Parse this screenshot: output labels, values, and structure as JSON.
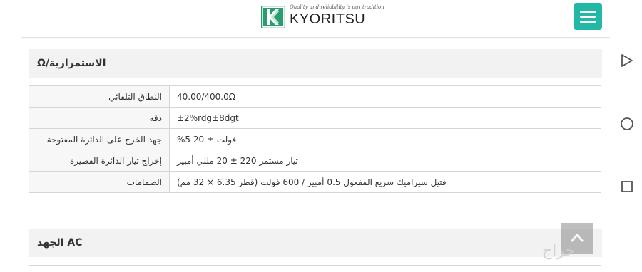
{
  "header": {
    "logo_tagline": "Quality and reliability is our tradition",
    "logo_word": "KYORITSU"
  },
  "section_continuity": {
    "title": "Ω/الاستمرارية"
  },
  "spec_table": [
    {
      "label": "النطاق التلقائي",
      "value": "40.00/400.0Ω"
    },
    {
      "label": "دقة",
      "value": "±2%rdg±8dgt"
    },
    {
      "label": "جهد الخرج على الدائرة المفتوحة",
      "value": "%فولت ± 20 5"
    },
    {
      "label": "إخراج تيار الدائرة القصيرة",
      "value": "تيار مستمر 220 ± 20 مللي أمبير"
    },
    {
      "label": "الصمامات",
      "value": "فتيل سيراميك سريع المفعول 0.5 أمبير / 600 فولت (قطر 6.35 × 32 مم)"
    }
  ],
  "section_ac": {
    "title": "الجهد AC"
  },
  "watermark": "حراج",
  "colors": {
    "menu_button": "#21b8a6",
    "logo_green": "#2a9d6f",
    "section_bg": "#f2f2f2"
  },
  "icons": {
    "menu": "hamburger-icon",
    "back": "triangle-back-icon",
    "home": "circle-home-icon",
    "recents": "square-recents-icon",
    "scroll_top": "chevron-up-icon"
  }
}
